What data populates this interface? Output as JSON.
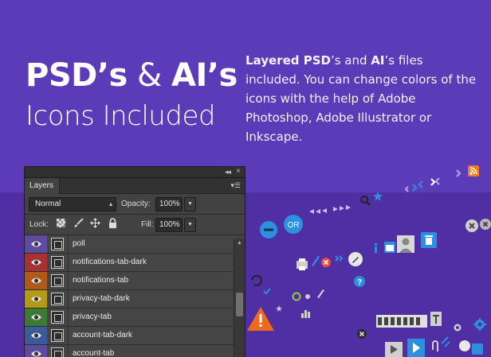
{
  "headline": {
    "part1": "PSD’s",
    "amp": " & ",
    "part2": "AI’s",
    "line2": "Icons Included"
  },
  "description": {
    "bold1": "Layered PSD",
    "text1": "’s and ",
    "bold2": "AI",
    "text2": "’s files included. You can change colors of the icons with the help of Adobe Photoshop, Adobe Illustrator or Inkscape."
  },
  "layers_panel": {
    "tab_label": "Layers",
    "blend_mode": "Normal",
    "opacity_label": "Opacity:",
    "opacity_value": "100%",
    "lock_label": "Lock:",
    "fill_label": "Fill:",
    "fill_value": "100%",
    "layers": [
      {
        "name": "poll",
        "color": "#5e4a9e"
      },
      {
        "name": "notifications-tab-dark",
        "color": "#a83232"
      },
      {
        "name": "notifications-tab",
        "color": "#b05a1a"
      },
      {
        "name": "privacy-tab-dark",
        "color": "#b59a18"
      },
      {
        "name": "privacy-tab",
        "color": "#3e7a35"
      },
      {
        "name": "account-tab-dark",
        "color": "#3b5a9a"
      },
      {
        "name": "account-tab",
        "color": "#5e4a9e"
      }
    ]
  },
  "icon_cloud": {
    "or_badge": "OR"
  },
  "colors": {
    "background_top": "#5b3bb7",
    "background_bottom": "#4f2fa3",
    "accent_blue": "#2d8fe0",
    "accent_orange": "#f06a1e"
  }
}
